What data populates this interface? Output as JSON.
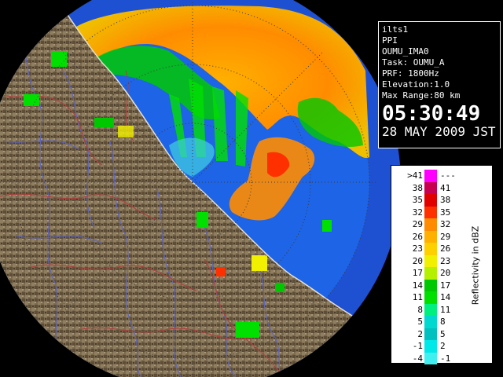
{
  "info": {
    "site": "ilts1",
    "product": "PPI",
    "volume": "OUMU_IMA0",
    "task": "Task: OUMU_A",
    "prf": "PRF: 1800Hz",
    "elevation": "Elevation:1.0",
    "max_range": "Max Range:80 km",
    "time": "05:30:49",
    "date": "28 MAY 2009 JST"
  },
  "legend": {
    "axis_label": "Reflectivity in dBZ",
    "rows": [
      {
        "lo": ">41",
        "hi": "---",
        "color": "#ff00ff"
      },
      {
        "lo": "38",
        "hi": "41",
        "color": "#c80050"
      },
      {
        "lo": "35",
        "hi": "38",
        "color": "#e00000"
      },
      {
        "lo": "32",
        "hi": "35",
        "color": "#ff3000"
      },
      {
        "lo": "29",
        "hi": "32",
        "color": "#ff8c00"
      },
      {
        "lo": "26",
        "hi": "29",
        "color": "#ffb000"
      },
      {
        "lo": "23",
        "hi": "26",
        "color": "#ffd000"
      },
      {
        "lo": "20",
        "hi": "23",
        "color": "#f0f000"
      },
      {
        "lo": "17",
        "hi": "20",
        "color": "#b4f000"
      },
      {
        "lo": "14",
        "hi": "17",
        "color": "#00c800"
      },
      {
        "lo": "11",
        "hi": "14",
        "color": "#00e000"
      },
      {
        "lo": "8",
        "hi": "11",
        "color": "#00f080"
      },
      {
        "lo": "5",
        "hi": "8",
        "color": "#00d8d0"
      },
      {
        "lo": "2",
        "hi": "5",
        "color": "#00c0c0"
      },
      {
        "lo": "-1",
        "hi": "2",
        "color": "#00e8e8"
      },
      {
        "lo": "-4",
        "hi": "-1",
        "color": "#40f0f0"
      }
    ]
  },
  "map_colors": {
    "ocean": "#1e64e6",
    "land": "#7a6a50",
    "outer_ocean": "#1e50d2",
    "rivers": "#5a64c8",
    "borders": "#b43c3c"
  }
}
